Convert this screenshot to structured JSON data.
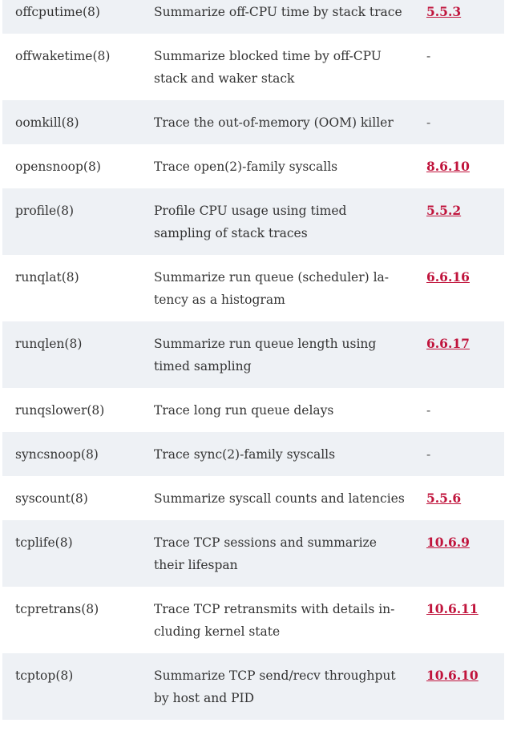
{
  "rows": [
    {
      "tool": "offcputime(8)",
      "description": "Summarize off-CPU time by stack trace",
      "section": "5.5.3",
      "shaded": true
    },
    {
      "tool": "offwaketime(8)",
      "description": "Summarize blocked time by off-CPU stack and waker stack",
      "section": "-",
      "shaded": false
    },
    {
      "tool": "oomkill(8)",
      "description": "Trace the out-of-memory (OOM) killer",
      "section": "-",
      "shaded": true
    },
    {
      "tool": "opensnoop(8)",
      "description": "Trace open(2)-family syscalls",
      "section": "8.6.10",
      "shaded": false
    },
    {
      "tool": "profile(8)",
      "description": "Profile CPU usage using timed sampling of stack traces",
      "section": "5.5.2",
      "shaded": true
    },
    {
      "tool": "runqlat(8)",
      "description": "Summarize run queue (scheduler) la­tency as a histogram",
      "section": "6.6.16",
      "shaded": false
    },
    {
      "tool": "runqlen(8)",
      "description": "Summarize run queue length using timed sampling",
      "section": "6.6.17",
      "shaded": true
    },
    {
      "tool": "runqslower(8)",
      "description": "Trace long run queue delays",
      "section": "-",
      "shaded": false
    },
    {
      "tool": "syncsnoop(8)",
      "description": "Trace sync(2)-family syscalls",
      "section": "-",
      "shaded": true
    },
    {
      "tool": "syscount(8)",
      "description": "Summarize syscall counts and latencies",
      "section": "5.5.6",
      "shaded": false
    },
    {
      "tool": "tcplife(8)",
      "description": "Trace TCP sessions and summarize their lifespan",
      "section": "10.6.9",
      "shaded": true
    },
    {
      "tool": "tcpretrans(8)",
      "description": "Trace TCP retransmits with details in­cluding kernel state",
      "section": "10.6.11",
      "shaded": false
    },
    {
      "tool": "tcptop(8)",
      "description": "Summarize TCP send/recv throughput by host and PID",
      "section": "10.6.10",
      "shaded": true
    }
  ]
}
